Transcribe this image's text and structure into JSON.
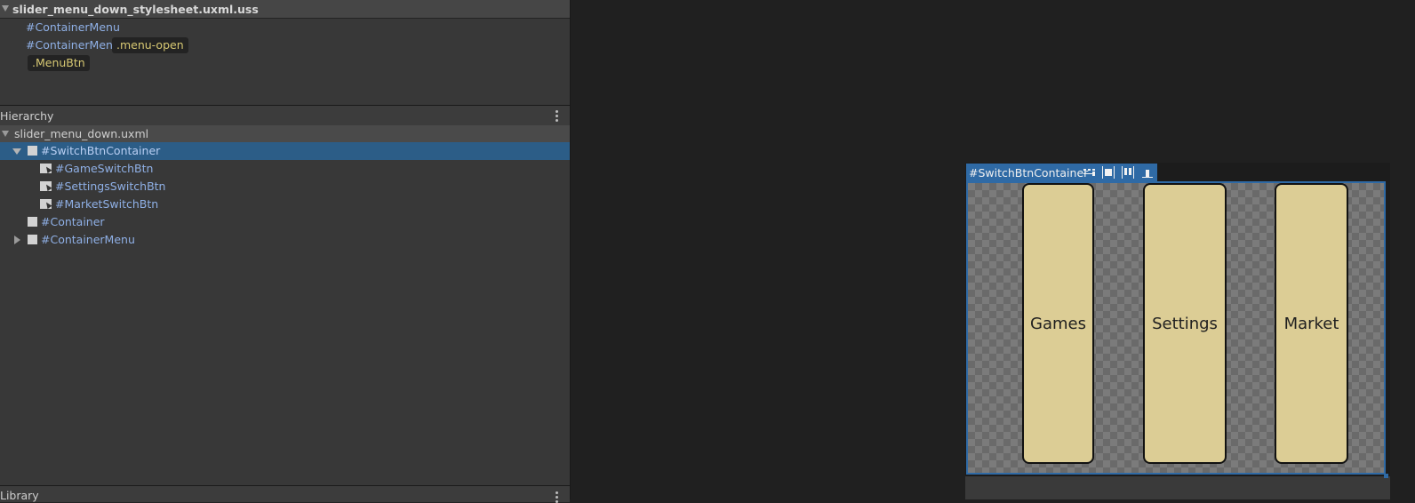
{
  "stylesheet": {
    "filename": "slider_menu_down_stylesheet.uxml.uss",
    "selectors": [
      {
        "id": "#ContainerMenu",
        "classes": []
      },
      {
        "id": "#ContainerMenu",
        "classes": [
          ".menu-open"
        ]
      },
      {
        "id": "",
        "classes": [
          ".MenuBtn"
        ]
      }
    ]
  },
  "hierarchy": {
    "title": "Hierarchy",
    "document": "slider_menu_down.uxml",
    "items": [
      {
        "label": "#SwitchBtnContainer",
        "selected": true,
        "expanded": true
      },
      {
        "label": "#GameSwitchBtn"
      },
      {
        "label": "#SettingsSwitchBtn"
      },
      {
        "label": "#MarketSwitchBtn"
      },
      {
        "label": "#Container"
      },
      {
        "label": "#ContainerMenu",
        "collapsed": true
      }
    ]
  },
  "library": {
    "title": "Library"
  },
  "canvas": {
    "selected_name": "#SwitchBtnContainer",
    "buttons": [
      "Games",
      "Settings",
      "Market"
    ],
    "colors": {
      "selection": "#2f6aa5",
      "button_fill": "#dccd95"
    }
  }
}
